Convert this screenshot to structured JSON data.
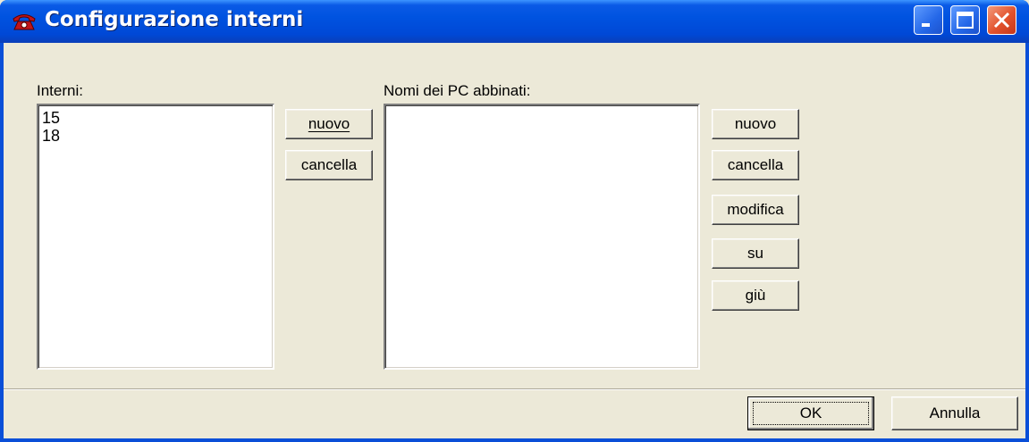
{
  "window": {
    "title": "Configurazione interni"
  },
  "interni": {
    "label": "Interni:",
    "items": [
      "15",
      "18"
    ],
    "nuovo_label": "nuovo",
    "cancella_label": "cancella"
  },
  "pc": {
    "label": "Nomi dei PC abbinati:",
    "items": [],
    "nuovo_label": "nuovo",
    "cancella_label": "cancella",
    "modifica_label": "modifica",
    "su_label": "su",
    "giu_label": "giù"
  },
  "footer": {
    "ok_label": "OK",
    "annulla_label": "Annulla"
  },
  "colors": {
    "titlebar": "#0054e3",
    "dialog_bg": "#ece9d8",
    "close_button": "#e2522c"
  },
  "icons": {
    "title": "telephone-icon",
    "minimize": "minimize-icon",
    "maximize": "maximize-icon",
    "close": "close-icon"
  }
}
